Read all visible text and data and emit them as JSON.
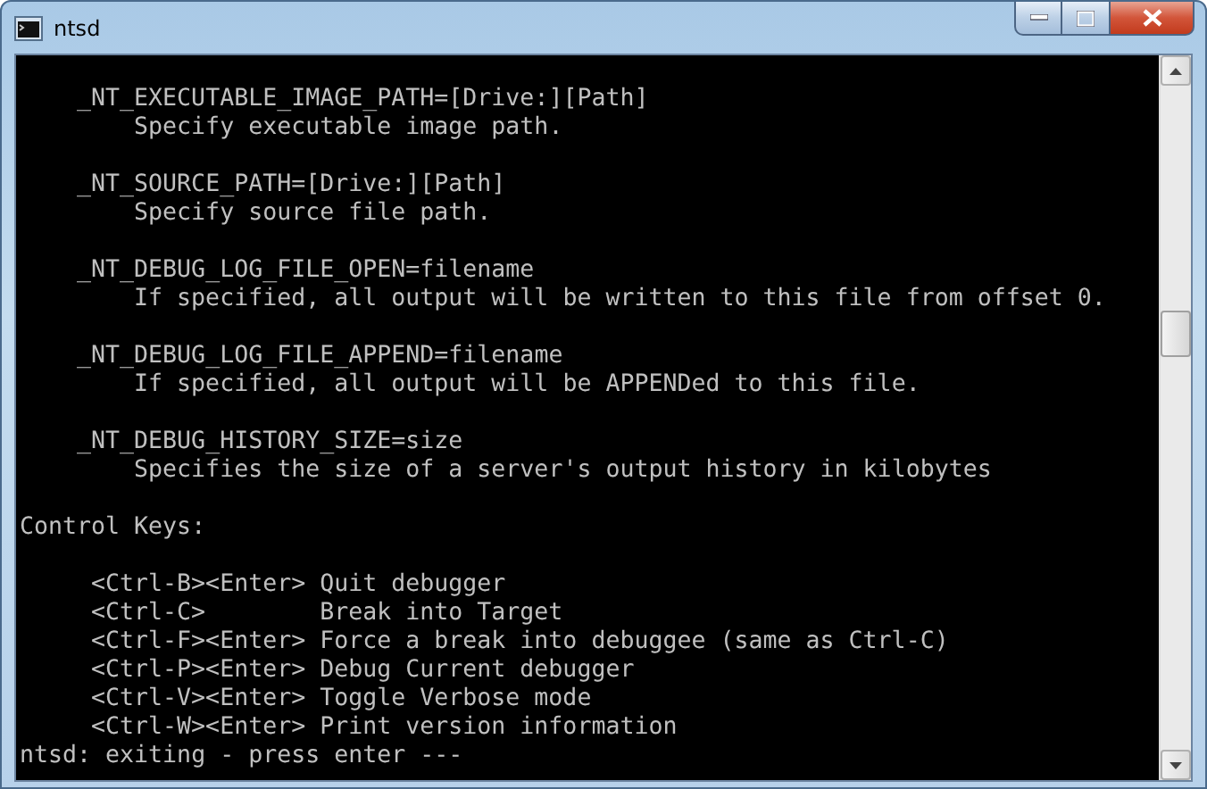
{
  "window": {
    "title": "ntsd"
  },
  "console": {
    "blocks": [
      {
        "lines": [
          {
            "kind": "var",
            "text": "_NT_EXECUTABLE_IMAGE_PATH=[Drive:][Path]"
          },
          {
            "kind": "desc",
            "text": "Specify executable image path."
          }
        ]
      },
      {
        "lines": [
          {
            "kind": "var",
            "text": "_NT_SOURCE_PATH=[Drive:][Path]"
          },
          {
            "kind": "desc",
            "text": "Specify source file path."
          }
        ]
      },
      {
        "lines": [
          {
            "kind": "var",
            "text": "_NT_DEBUG_LOG_FILE_OPEN=filename"
          },
          {
            "kind": "desc",
            "text": "If specified, all output will be written to this file from offset 0."
          }
        ]
      },
      {
        "lines": [
          {
            "kind": "var",
            "text": "_NT_DEBUG_LOG_FILE_APPEND=filename"
          },
          {
            "kind": "desc",
            "text": "If specified, all output will be APPENDed to this file."
          }
        ]
      },
      {
        "lines": [
          {
            "kind": "var",
            "text": "_NT_DEBUG_HISTORY_SIZE=size"
          },
          {
            "kind": "desc",
            "text": "Specifies the size of a server's output history in kilobytes"
          }
        ]
      },
      {
        "lines": [
          {
            "kind": "heading",
            "text": "Control Keys:"
          }
        ]
      },
      {
        "lines": [
          {
            "kind": "key",
            "key": "<Ctrl-B><Enter>",
            "text": "Quit debugger"
          },
          {
            "kind": "key",
            "key": "<Ctrl-C>",
            "text": "Break into Target"
          },
          {
            "kind": "key",
            "key": "<Ctrl-F><Enter>",
            "text": "Force a break into debuggee (same as Ctrl-C)"
          },
          {
            "kind": "key",
            "key": "<Ctrl-P><Enter>",
            "text": "Debug Current debugger"
          },
          {
            "kind": "key",
            "key": "<Ctrl-V><Enter>",
            "text": "Toggle Verbose mode"
          },
          {
            "kind": "key",
            "key": "<Ctrl-W><Enter>",
            "text": "Print version information"
          },
          {
            "kind": "prompt",
            "text": "ntsd: exiting - press enter ---"
          }
        ]
      }
    ]
  }
}
